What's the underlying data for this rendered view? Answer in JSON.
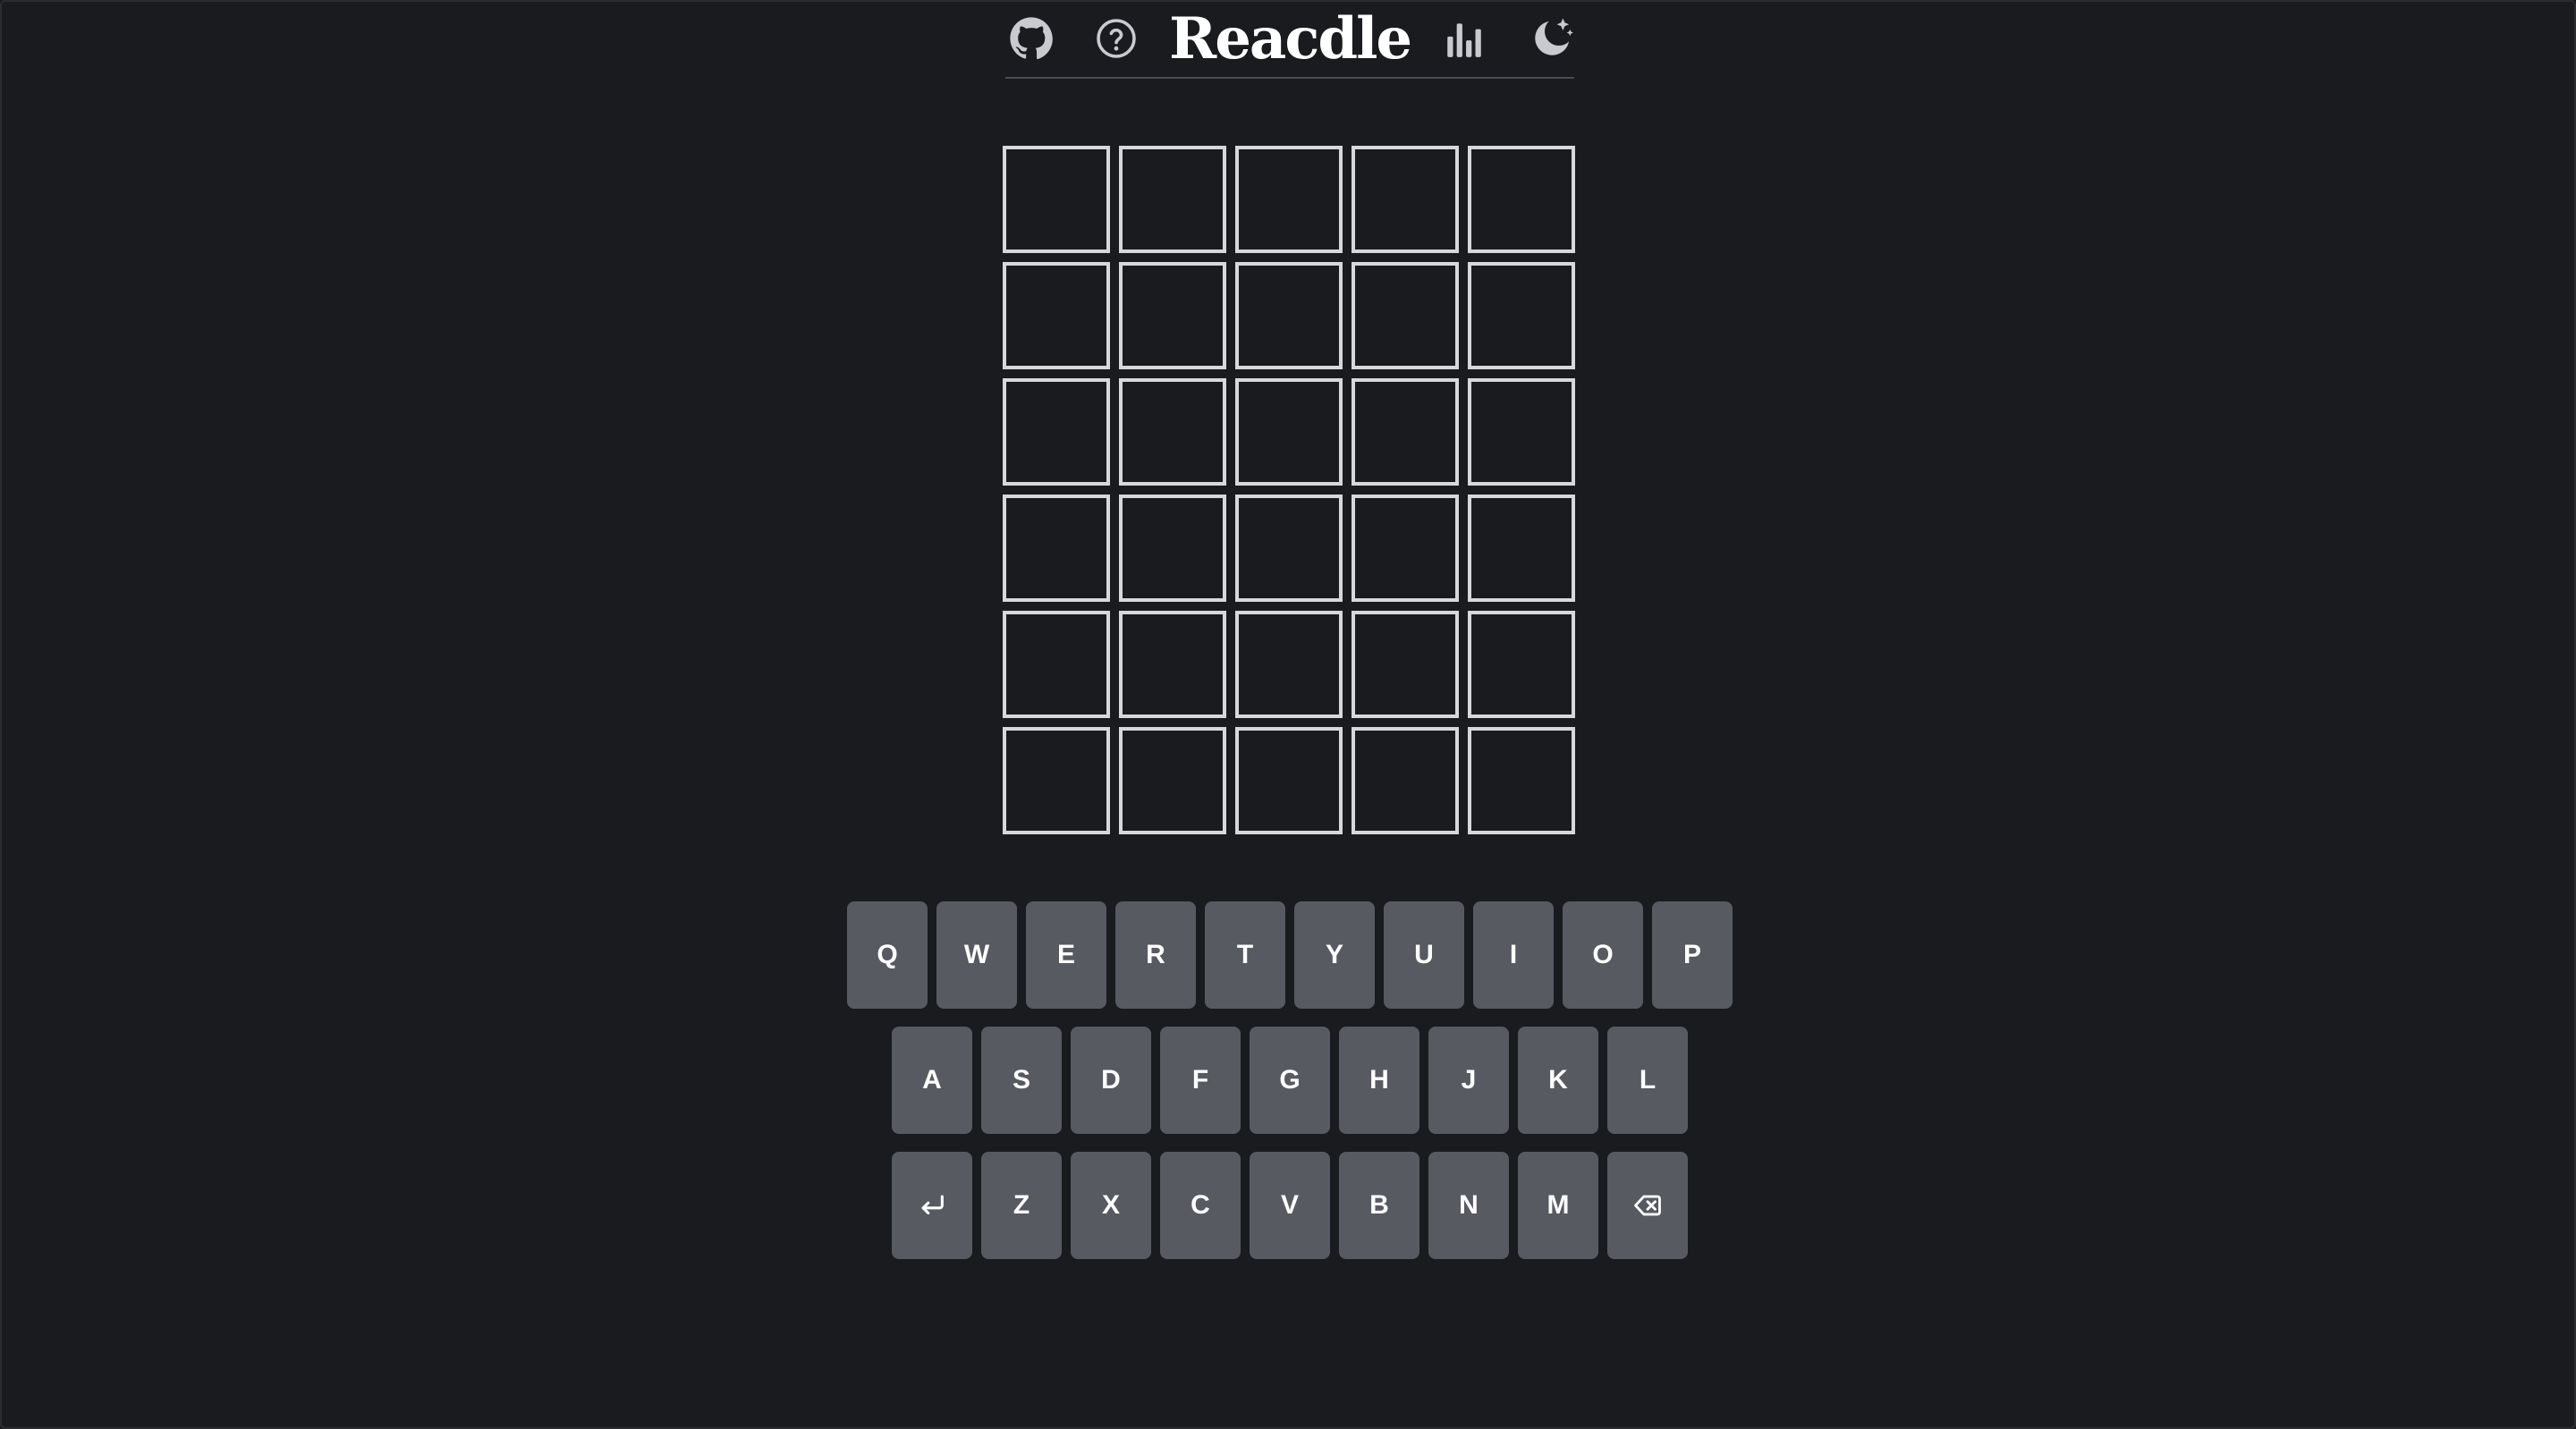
{
  "header": {
    "title": "Reacdle",
    "icons": [
      "github-icon",
      "help-icon",
      "stats-icon",
      "theme-icon"
    ]
  },
  "board": {
    "rows": [
      [
        "",
        "",
        "",
        "",
        ""
      ],
      [
        "",
        "",
        "",
        "",
        ""
      ],
      [
        "",
        "",
        "",
        "",
        ""
      ],
      [
        "",
        "",
        "",
        "",
        ""
      ],
      [
        "",
        "",
        "",
        "",
        ""
      ],
      [
        "",
        "",
        "",
        "",
        ""
      ]
    ]
  },
  "keyboard": {
    "row1": [
      "Q",
      "W",
      "E",
      "R",
      "T",
      "Y",
      "U",
      "I",
      "O",
      "P"
    ],
    "row2": [
      "A",
      "S",
      "D",
      "F",
      "G",
      "H",
      "J",
      "K",
      "L"
    ],
    "row3": [
      "Z",
      "X",
      "C",
      "V",
      "B",
      "N",
      "M"
    ],
    "enter_icon": "enter-icon",
    "backspace_icon": "backspace-icon"
  },
  "colors": {
    "background": "#1a1b1e",
    "tile_border": "#d6d8dc",
    "key_background": "#575a61",
    "icon": "#c8cacf"
  }
}
